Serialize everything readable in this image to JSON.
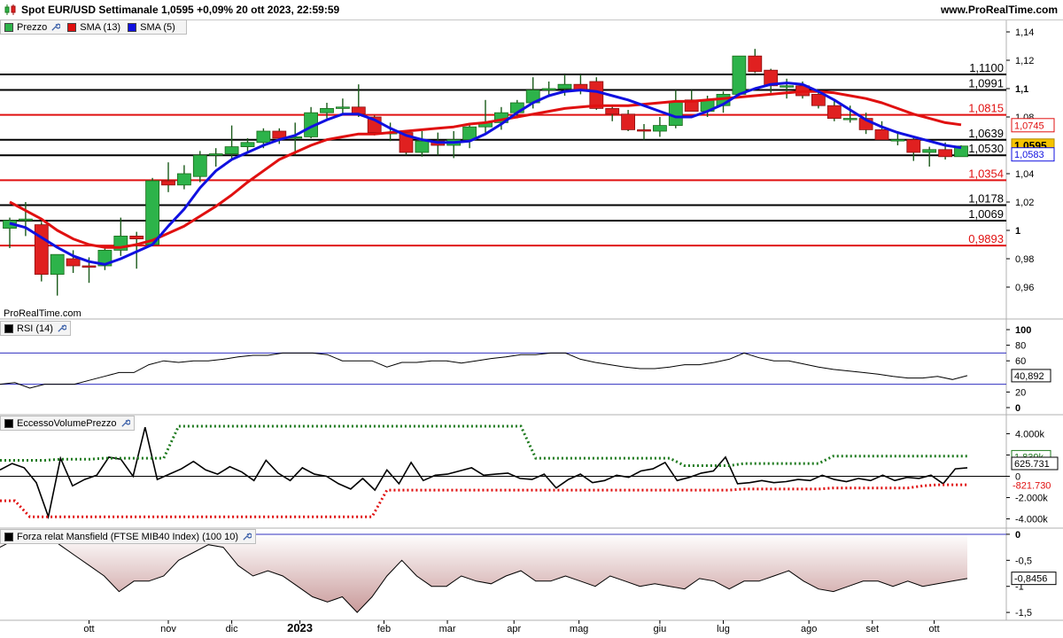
{
  "header": {
    "title": "Spot EUR/USD Settimanale 1,0595 +0,09% 20 ott 2023, 22:59:59",
    "site": "www.ProRealTime.com"
  },
  "watermark": "ProRealTime.com",
  "colors": {
    "up": "#2db34a",
    "down": "#e02020",
    "sma13": "#e01010",
    "sma5": "#1010e0",
    "res_green": "#1f7a1f"
  },
  "price_panel": {
    "legend": [
      {
        "label": "Prezzo",
        "color": "#2db34a",
        "icon": "wrench-icon"
      },
      {
        "label": "SMA (13)",
        "color": "#e01010"
      },
      {
        "label": "SMA (5)",
        "color": "#1010e0"
      }
    ],
    "ylim": [
      0.945,
      1.145
    ],
    "yticks": [
      {
        "v": 1.14,
        "t": "1,14"
      },
      {
        "v": 1.12,
        "t": "1,12"
      },
      {
        "v": 1.1,
        "t": "1,1"
      },
      {
        "v": 1.08,
        "t": "1,08"
      },
      {
        "v": 1.04,
        "t": "1,04"
      },
      {
        "v": 1.02,
        "t": "1,02"
      },
      {
        "v": 1.0,
        "t": "1"
      },
      {
        "v": 0.98,
        "t": "0,98"
      },
      {
        "v": 0.96,
        "t": "0,96"
      }
    ],
    "levels": [
      {
        "v": 1.11,
        "t": "1,1100",
        "color": "black"
      },
      {
        "v": 1.0991,
        "t": "1,0991",
        "color": "black"
      },
      {
        "v": 1.0815,
        "t": "1,0815",
        "color": "red"
      },
      {
        "v": 1.0639,
        "t": "1,0639",
        "color": "black"
      },
      {
        "v": 1.053,
        "t": "1,0530",
        "color": "black"
      },
      {
        "v": 1.0354,
        "t": "1,0354",
        "color": "red"
      },
      {
        "v": 1.0178,
        "t": "1,0178",
        "color": "black"
      },
      {
        "v": 1.0069,
        "t": "1,0069",
        "color": "black"
      },
      {
        "v": 0.9893,
        "t": "0,9893",
        "color": "red"
      }
    ],
    "badges": [
      {
        "v": 1.0745,
        "t": "1,0745",
        "style": "red"
      },
      {
        "v": 1.0595,
        "t": "1,0595",
        "style": "price"
      },
      {
        "v": 1.0583,
        "t": "1,0583",
        "style": "blue"
      }
    ]
  },
  "rsi_panel": {
    "legend": "RSI (14)",
    "ylim": [
      0,
      100
    ],
    "yticks": [
      {
        "v": 100,
        "t": "100"
      },
      {
        "v": 80,
        "t": "80"
      },
      {
        "v": 60,
        "t": "60"
      },
      {
        "v": 20,
        "t": "20"
      },
      {
        "v": 0,
        "t": "0"
      }
    ],
    "bands": [
      70,
      30
    ],
    "badge": "40,892",
    "values": [
      30,
      32,
      25,
      30,
      30,
      30,
      35,
      40,
      45,
      45,
      55,
      60,
      58,
      60,
      60,
      62,
      65,
      67,
      67,
      70,
      70,
      70,
      68,
      60,
      60,
      60,
      52,
      58,
      58,
      60,
      60,
      57,
      60,
      63,
      65,
      68,
      68,
      70,
      70,
      62,
      58,
      55,
      52,
      50,
      50,
      52,
      55,
      55,
      58,
      62,
      70,
      64,
      60,
      60,
      56,
      52,
      49,
      47,
      45,
      43,
      40,
      38,
      38,
      40,
      36,
      41
    ]
  },
  "volume_panel": {
    "legend": "EccessoVolumePrezzo",
    "ylim": [
      -5200,
      5200
    ],
    "yticks": [
      {
        "v": 4000,
        "t": "4.000k"
      },
      {
        "v": 2000,
        "t": "2.000k"
      },
      {
        "v": 0,
        "t": "0"
      },
      {
        "v": -2000,
        "t": "-2.000k"
      },
      {
        "v": -4000,
        "t": "-4.000k"
      }
    ],
    "badges": [
      {
        "v": 1839,
        "t": "1.839k",
        "style": "green"
      },
      {
        "v": 625,
        "t": "625.731",
        "style": "plain"
      },
      {
        "v": -821,
        "t": "-821.730",
        "style": "redtext"
      }
    ],
    "values": [
      600,
      1200,
      800,
      -600,
      -3800,
      1700,
      -900,
      -300,
      100,
      1800,
      1600,
      0,
      4600,
      -300,
      200,
      700,
      1400,
      600,
      200,
      900,
      400,
      -400,
      1500,
      300,
      -400,
      800,
      200,
      0,
      -700,
      -1200,
      -200,
      -1300,
      600,
      -700,
      1300,
      -400,
      100,
      200,
      500,
      800,
      100,
      200,
      300,
      -200,
      -300,
      200,
      -1100,
      -300,
      200,
      -600,
      -400,
      100,
      -100,
      500,
      700,
      1300,
      -400,
      -100,
      300,
      500,
      1800,
      -700,
      -600,
      -400,
      -600,
      -500,
      -300,
      -400,
      100,
      -300,
      -500,
      -200,
      -400,
      100,
      -400,
      -100,
      -200,
      100,
      -700,
      700,
      800
    ],
    "upper": [
      1500,
      1500,
      1500,
      1500,
      1600,
      1600,
      1600,
      1700,
      1700,
      1700,
      1700,
      1700,
      4700,
      4700,
      4700,
      4700,
      4700,
      4700,
      4700,
      4700,
      4700,
      4700,
      4700,
      4700,
      4700,
      4700,
      4700,
      4700,
      4700,
      4700,
      4700,
      4700,
      4700,
      4700,
      4700,
      4700,
      1700,
      1700,
      1700,
      1700,
      1700,
      1700,
      1700,
      1700,
      1700,
      1700,
      1000,
      1000,
      1000,
      1000,
      1200,
      1200,
      1200,
      1200,
      1200,
      1200,
      1900,
      1900,
      1900,
      1900,
      1900,
      1900,
      1900,
      1900,
      1900,
      1900
    ],
    "lower": [
      -2300,
      -2300,
      -3800,
      -3800,
      -3800,
      -3800,
      -3800,
      -3800,
      -3800,
      -3800,
      -3800,
      -3800,
      -3800,
      -3800,
      -3800,
      -3800,
      -3800,
      -3800,
      -3800,
      -3800,
      -3800,
      -3800,
      -3800,
      -3800,
      -3800,
      -3800,
      -1300,
      -1300,
      -1300,
      -1300,
      -1300,
      -1300,
      -1300,
      -1300,
      -1300,
      -1300,
      -1300,
      -1300,
      -1300,
      -1300,
      -1300,
      -1300,
      -1300,
      -1300,
      -1300,
      -1300,
      -1300,
      -1300,
      -1300,
      -1300,
      -1200,
      -1200,
      -1200,
      -1200,
      -1200,
      -1200,
      -1100,
      -1100,
      -1100,
      -1100,
      -1100,
      -1100,
      -900,
      -800,
      -800,
      -800
    ]
  },
  "mansfield_panel": {
    "legend": "Forza relat Mansfield (FTSE MIB40 Index) (100 10)",
    "ylim": [
      -1.6,
      0.05
    ],
    "yticks": [
      {
        "v": 0,
        "t": "0"
      },
      {
        "v": -0.5,
        "t": "-0,5"
      },
      {
        "v": -1,
        "t": "-1"
      },
      {
        "v": -1.5,
        "t": "-1,5"
      }
    ],
    "badge": {
      "v": -0.8456,
      "t": "-0,8456"
    },
    "values": [
      -0.25,
      -0.1,
      0.02,
      0.02,
      -0.2,
      -0.4,
      -0.6,
      -0.8,
      -1.1,
      -0.9,
      -0.9,
      -0.8,
      -0.5,
      -0.35,
      -0.2,
      -0.25,
      -0.6,
      -0.8,
      -0.7,
      -0.8,
      -1.0,
      -1.2,
      -1.3,
      -1.2,
      -1.5,
      -1.2,
      -0.8,
      -0.5,
      -0.8,
      -1.0,
      -1.0,
      -0.8,
      -0.9,
      -0.95,
      -0.8,
      -0.7,
      -0.9,
      -0.9,
      -0.8,
      -0.9,
      -1.0,
      -0.8,
      -0.9,
      -1.0,
      -0.95,
      -1.0,
      -1.05,
      -0.85,
      -0.9,
      -1.05,
      -0.9,
      -0.9,
      -0.8,
      -0.7,
      -0.9,
      -1.05,
      -1.1,
      -1.0,
      -0.9,
      -0.9,
      -1.0,
      -0.9,
      -1.0,
      -0.95,
      -0.9,
      -0.85
    ]
  },
  "x_axis": {
    "labels": [
      {
        "i": 5,
        "t": "ott"
      },
      {
        "i": 10,
        "t": "nov"
      },
      {
        "i": 14,
        "t": "dic"
      },
      {
        "i": 18.3,
        "t": "2023",
        "bold": true
      },
      {
        "i": 23.6,
        "t": "feb"
      },
      {
        "i": 27.6,
        "t": "mar"
      },
      {
        "i": 31.8,
        "t": "apr"
      },
      {
        "i": 35.9,
        "t": "mag"
      },
      {
        "i": 41.0,
        "t": "giu"
      },
      {
        "i": 45.0,
        "t": "lug"
      },
      {
        "i": 50.4,
        "t": "ago"
      },
      {
        "i": 54.4,
        "t": "set"
      },
      {
        "i": 58.3,
        "t": "ott"
      }
    ]
  },
  "chart_data": {
    "type": "candlestick",
    "title": "Spot EUR/USD Settimanale",
    "x_start_index": 0,
    "candles": [
      {
        "o": 1.0015,
        "h": 1.009,
        "l": 0.9875,
        "c": 1.007
      },
      {
        "o": 1.007,
        "h": 1.02,
        "l": 0.996,
        "c": 1.008
      },
      {
        "o": 1.004,
        "h": 1.006,
        "l": 0.964,
        "c": 0.969
      },
      {
        "o": 0.969,
        "h": 0.982,
        "l": 0.954,
        "c": 0.983
      },
      {
        "o": 0.98,
        "h": 0.986,
        "l": 0.97,
        "c": 0.975
      },
      {
        "o": 0.975,
        "h": 0.981,
        "l": 0.963,
        "c": 0.974
      },
      {
        "o": 0.975,
        "h": 0.988,
        "l": 0.972,
        "c": 0.986
      },
      {
        "o": 0.986,
        "h": 1.009,
        "l": 0.982,
        "c": 0.996
      },
      {
        "o": 0.996,
        "h": 0.999,
        "l": 0.973,
        "c": 0.994
      },
      {
        "o": 0.99,
        "h": 1.037,
        "l": 0.989,
        "c": 1.035
      },
      {
        "o": 1.035,
        "h": 1.048,
        "l": 1.027,
        "c": 1.032
      },
      {
        "o": 1.032,
        "h": 1.046,
        "l": 1.029,
        "c": 1.04
      },
      {
        "o": 1.038,
        "h": 1.056,
        "l": 1.034,
        "c": 1.053
      },
      {
        "o": 1.053,
        "h": 1.058,
        "l": 1.045,
        "c": 1.054
      },
      {
        "o": 1.054,
        "h": 1.074,
        "l": 1.05,
        "c": 1.059
      },
      {
        "o": 1.059,
        "h": 1.065,
        "l": 1.055,
        "c": 1.062
      },
      {
        "o": 1.062,
        "h": 1.072,
        "l": 1.058,
        "c": 1.07
      },
      {
        "o": 1.07,
        "h": 1.072,
        "l": 1.061,
        "c": 1.065
      },
      {
        "o": 1.065,
        "h": 1.076,
        "l": 1.053,
        "c": 1.066
      },
      {
        "o": 1.066,
        "h": 1.087,
        "l": 1.065,
        "c": 1.083
      },
      {
        "o": 1.083,
        "h": 1.09,
        "l": 1.079,
        "c": 1.086
      },
      {
        "o": 1.086,
        "h": 1.093,
        "l": 1.082,
        "c": 1.087
      },
      {
        "o": 1.087,
        "h": 1.103,
        "l": 1.08,
        "c": 1.082
      },
      {
        "o": 1.08,
        "h": 1.081,
        "l": 1.067,
        "c": 1.069
      },
      {
        "o": 1.069,
        "h": 1.076,
        "l": 1.063,
        "c": 1.069
      },
      {
        "o": 1.069,
        "h": 1.07,
        "l": 1.053,
        "c": 1.055
      },
      {
        "o": 1.055,
        "h": 1.07,
        "l": 1.052,
        "c": 1.063
      },
      {
        "o": 1.063,
        "h": 1.069,
        "l": 1.053,
        "c": 1.06
      },
      {
        "o": 1.06,
        "h": 1.07,
        "l": 1.051,
        "c": 1.064
      },
      {
        "o": 1.064,
        "h": 1.075,
        "l": 1.058,
        "c": 1.073
      },
      {
        "o": 1.073,
        "h": 1.092,
        "l": 1.069,
        "c": 1.076
      },
      {
        "o": 1.076,
        "h": 1.087,
        "l": 1.071,
        "c": 1.083
      },
      {
        "o": 1.083,
        "h": 1.092,
        "l": 1.079,
        "c": 1.09
      },
      {
        "o": 1.09,
        "h": 1.108,
        "l": 1.086,
        "c": 1.099
      },
      {
        "o": 1.099,
        "h": 1.105,
        "l": 1.094,
        "c": 1.1
      },
      {
        "o": 1.1,
        "h": 1.11,
        "l": 1.095,
        "c": 1.103
      },
      {
        "o": 1.103,
        "h": 1.11,
        "l": 1.096,
        "c": 1.099
      },
      {
        "o": 1.105,
        "h": 1.108,
        "l": 1.085,
        "c": 1.086
      },
      {
        "o": 1.086,
        "h": 1.088,
        "l": 1.077,
        "c": 1.082
      },
      {
        "o": 1.082,
        "h": 1.085,
        "l": 1.07,
        "c": 1.071
      },
      {
        "o": 1.071,
        "h": 1.075,
        "l": 1.064,
        "c": 1.07
      },
      {
        "o": 1.07,
        "h": 1.08,
        "l": 1.066,
        "c": 1.074
      },
      {
        "o": 1.074,
        "h": 1.099,
        "l": 1.072,
        "c": 1.091
      },
      {
        "o": 1.092,
        "h": 1.099,
        "l": 1.085,
        "c": 1.084
      },
      {
        "o": 1.084,
        "h": 1.095,
        "l": 1.08,
        "c": 1.092
      },
      {
        "o": 1.088,
        "h": 1.098,
        "l": 1.083,
        "c": 1.096
      },
      {
        "o": 1.096,
        "h": 1.123,
        "l": 1.095,
        "c": 1.123
      },
      {
        "o": 1.123,
        "h": 1.128,
        "l": 1.111,
        "c": 1.112
      },
      {
        "o": 1.113,
        "h": 1.114,
        "l": 1.097,
        "c": 1.102
      },
      {
        "o": 1.102,
        "h": 1.107,
        "l": 1.093,
        "c": 1.102
      },
      {
        "o": 1.102,
        "h": 1.105,
        "l": 1.093,
        "c": 1.095
      },
      {
        "o": 1.096,
        "h": 1.099,
        "l": 1.086,
        "c": 1.088
      },
      {
        "o": 1.088,
        "h": 1.092,
        "l": 1.077,
        "c": 1.079
      },
      {
        "o": 1.079,
        "h": 1.088,
        "l": 1.076,
        "c": 1.079
      },
      {
        "o": 1.079,
        "h": 1.083,
        "l": 1.068,
        "c": 1.071
      },
      {
        "o": 1.071,
        "h": 1.077,
        "l": 1.064,
        "c": 1.064
      },
      {
        "o": 1.064,
        "h": 1.07,
        "l": 1.06,
        "c": 1.064
      },
      {
        "o": 1.064,
        "h": 1.066,
        "l": 1.049,
        "c": 1.055
      },
      {
        "o": 1.055,
        "h": 1.059,
        "l": 1.045,
        "c": 1.057
      },
      {
        "o": 1.057,
        "h": 1.062,
        "l": 1.05,
        "c": 1.052
      },
      {
        "o": 1.052,
        "h": 1.06,
        "l": 1.052,
        "c": 1.0595
      }
    ],
    "sma13": [
      1.02,
      1.014,
      1.008,
      1.0,
      0.994,
      0.99,
      0.988,
      0.988,
      0.99,
      0.993,
      0.998,
      1.003,
      1.01,
      1.017,
      1.025,
      1.034,
      1.042,
      1.05,
      1.055,
      1.06,
      1.064,
      1.066,
      1.068,
      1.068,
      1.069,
      1.07,
      1.071,
      1.072,
      1.073,
      1.075,
      1.076,
      1.078,
      1.08,
      1.082,
      1.084,
      1.086,
      1.087,
      1.088,
      1.088,
      1.088,
      1.089,
      1.09,
      1.091,
      1.091,
      1.092,
      1.093,
      1.094,
      1.095,
      1.096,
      1.097,
      1.098,
      1.098,
      1.097,
      1.095,
      1.093,
      1.09,
      1.086,
      1.082,
      1.079,
      1.076,
      1.0745
    ],
    "sma5": [
      1.005,
      1.002,
      0.995,
      0.988,
      0.982,
      0.978,
      0.976,
      0.98,
      0.985,
      0.99,
      1.003,
      1.015,
      1.03,
      1.042,
      1.05,
      1.055,
      1.06,
      1.064,
      1.067,
      1.073,
      1.078,
      1.082,
      1.082,
      1.078,
      1.072,
      1.067,
      1.064,
      1.062,
      1.062,
      1.063,
      1.068,
      1.075,
      1.083,
      1.09,
      1.095,
      1.098,
      1.099,
      1.098,
      1.095,
      1.092,
      1.088,
      1.084,
      1.08,
      1.08,
      1.084,
      1.089,
      1.096,
      1.1,
      1.103,
      1.104,
      1.103,
      1.098,
      1.092,
      1.085,
      1.078,
      1.073,
      1.069,
      1.066,
      1.063,
      1.06,
      1.0583
    ]
  }
}
